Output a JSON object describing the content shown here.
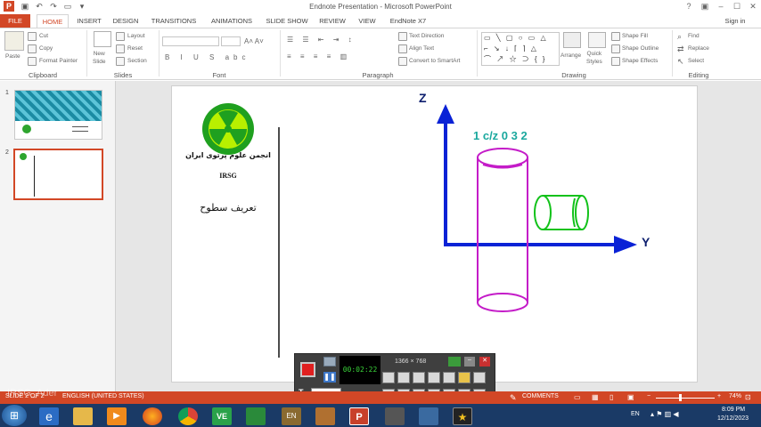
{
  "window": {
    "title": "Endnote Presentation - Microsoft PowerPoint",
    "sign_in": "Sign in"
  },
  "tabs": [
    "FILE",
    "HOME",
    "INSERT",
    "DESIGN",
    "TRANSITIONS",
    "ANIMATIONS",
    "SLIDE SHOW",
    "REVIEW",
    "VIEW",
    "EndNote X7"
  ],
  "ribbon": {
    "clipboard": {
      "label": "Clipboard",
      "paste": "Paste",
      "cut": "Cut",
      "copy": "Copy",
      "format_painter": "Format Painter"
    },
    "slides": {
      "label": "Slides",
      "new_slide": "New\nSlide",
      "layout": "Layout",
      "reset": "Reset",
      "section": "Section"
    },
    "font": {
      "label": "Font"
    },
    "paragraph": {
      "label": "Paragraph",
      "text_direction": "Text Direction",
      "align_text": "Align Text",
      "convert_smartart": "Convert to SmartArt"
    },
    "drawing": {
      "label": "Drawing",
      "arrange": "Arrange",
      "quick_styles": "Quick\nStyles",
      "shape_fill": "Shape Fill",
      "shape_outline": "Shape Outline",
      "shape_effects": "Shape Effects"
    },
    "editing": {
      "label": "Editing",
      "find": "Find",
      "replace": "Replace",
      "select": "Select"
    }
  },
  "thumbnails": [
    {
      "num": "1"
    },
    {
      "num": "2"
    }
  ],
  "slide": {
    "logo_label": "IRSG",
    "logo_arc_text": "انجمن علوم پرتوی ایران",
    "arabic_heading": "تعریف سطوح",
    "axis_z": "Z",
    "axis_y": "Y",
    "cyl_label": "1 c/z 0 3 2"
  },
  "recorder": {
    "resolution": "1366 × 768",
    "timer": "00:02:22"
  },
  "status": {
    "slide_info": "SLIDE 2 OF 2",
    "language": "ENGLISH (UNITED STATES)",
    "comments": "COMMENTS",
    "zoom": "74%",
    "watermark": "IRSG_Ader"
  },
  "taskbar": {
    "lang": "EN",
    "time": "8:09 PM",
    "date": "12/12/2023"
  },
  "colors": {
    "accent": "#d24726",
    "axis": "#0a22d6",
    "cyl_magenta": "#c41cc8",
    "cyl_green": "#12c21a",
    "label_teal": "#1aa89e"
  }
}
